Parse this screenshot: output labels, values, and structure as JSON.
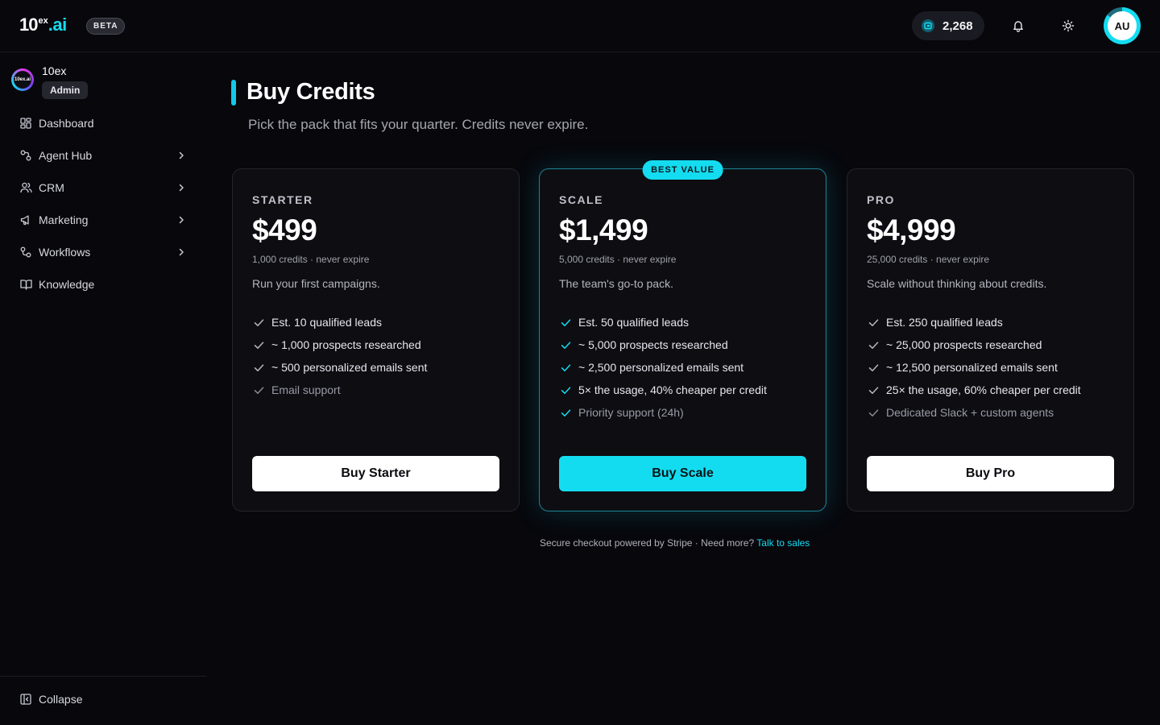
{
  "header": {
    "logo": {
      "main": "10",
      "sup": "ex",
      "suffix": ".ai"
    },
    "beta_label": "BETA",
    "credits_balance": "2,268",
    "avatar_initials": "AU"
  },
  "sidebar": {
    "org_name": "10ex",
    "org_logo_text": "10ex.ai",
    "role": "Admin",
    "items": [
      {
        "label": "Dashboard",
        "icon": "grid-icon",
        "has_chevron": false
      },
      {
        "label": "Agent Hub",
        "icon": "agent-icon",
        "has_chevron": true
      },
      {
        "label": "CRM",
        "icon": "users-icon",
        "has_chevron": true
      },
      {
        "label": "Marketing",
        "icon": "megaphone-icon",
        "has_chevron": true
      },
      {
        "label": "Workflows",
        "icon": "workflow-icon",
        "has_chevron": true
      },
      {
        "label": "Knowledge",
        "icon": "book-icon",
        "has_chevron": false
      }
    ],
    "collapse_label": "Collapse"
  },
  "main": {
    "title": "Buy Credits",
    "subtitle": "Pick the pack that fits your quarter. Credits never expire.",
    "plans": [
      {
        "tier": "STARTER",
        "price": "$499",
        "credits_note": "1,000 credits · never expire",
        "tagline": "Run your first campaigns.",
        "features": [
          "Est. 10 qualified leads",
          "~ 1,000 prospects researched",
          "~ 500 personalized emails sent",
          "Email support"
        ],
        "button": "Buy Starter"
      },
      {
        "tier": "SCALE",
        "badge": "BEST VALUE",
        "price": "$1,499",
        "credits_note": "5,000 credits · never expire",
        "tagline": "The team's go-to pack.",
        "features": [
          "Est. 50 qualified leads",
          "~ 5,000 prospects researched",
          "~ 2,500 personalized emails sent",
          "5× the usage, 40% cheaper per credit",
          "Priority support (24h)"
        ],
        "button": "Buy Scale"
      },
      {
        "tier": "PRO",
        "price": "$4,999",
        "credits_note": "25,000 credits · never expire",
        "tagline": "Scale without thinking about credits.",
        "features": [
          "Est. 250 qualified leads",
          "~ 25,000 prospects researched",
          "~ 12,500 personalized emails sent",
          "25× the usage, 60% cheaper per credit",
          "Dedicated Slack + custom agents"
        ],
        "button": "Buy Pro"
      }
    ],
    "footer_text": "Secure checkout powered by Stripe · Need more?",
    "footer_link": "Talk to sales"
  },
  "colors": {
    "accent": "#14dcf0",
    "background": "#07070c",
    "card": "#0d0d12"
  }
}
